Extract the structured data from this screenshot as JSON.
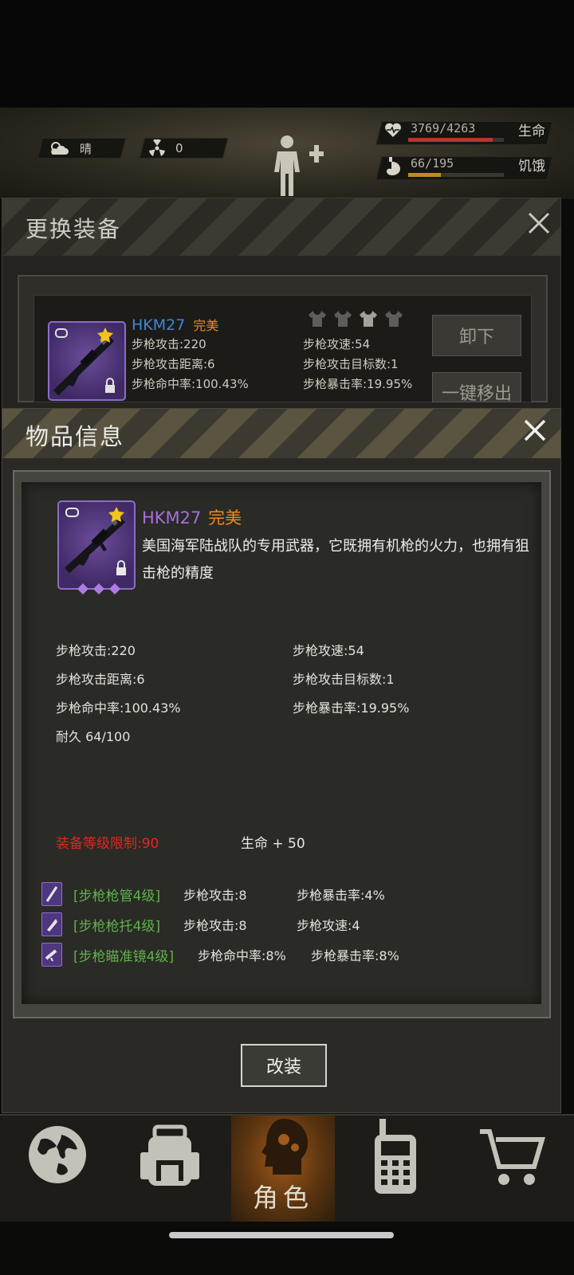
{
  "status": {
    "weather": "晴",
    "radiation": "0",
    "health": {
      "value": "3769/4263",
      "label": "生命",
      "ratio": 0.884,
      "color": "#b8352e"
    },
    "hunger": {
      "value": "66/195",
      "label": "饥饿",
      "ratio": 0.338,
      "color": "#c08a1e"
    }
  },
  "equip_panel": {
    "title": "更换装备",
    "item": {
      "name": "HKM27",
      "quality": "完美",
      "stats_left": [
        "步枪攻击:220",
        "步枪攻击距离:6",
        "步枪命中率:100.43%"
      ],
      "stats_right": [
        "步枪攻速:54",
        "步枪攻击目标数:1",
        "步枪暴击率:19.95%"
      ]
    },
    "unequip_label": "卸下",
    "remove_all_label": "一键移出"
  },
  "item_info": {
    "title": "物品信息",
    "name": "HKM27",
    "quality": "完美",
    "description": "美国海军陆战队的专用武器，它既拥有机枪的火力，也拥有狙击枪的精度",
    "stats_left": [
      "步枪攻击:220",
      "步枪攻击距离:6",
      "步枪命中率:100.43%",
      "耐久 64/100"
    ],
    "stats_right": [
      "步枪攻速:54",
      "步枪攻击目标数:1",
      "步枪暴击率:19.95%"
    ],
    "level_req": "装备等级限制:90",
    "bonus": "生命 + 50",
    "mods": [
      {
        "name": "[步枪枪管4级]",
        "stat1": "步枪攻击:8",
        "stat2": "步枪暴击率:4%"
      },
      {
        "name": "[步枪枪托4级]",
        "stat1": "步枪攻击:8",
        "stat2": "步枪攻速:4"
      },
      {
        "name": "[步枪瞄准镜4级]",
        "stat1": "步枪命中率:8%",
        "stat2": "步枪暴击率:8%"
      }
    ],
    "modify_label": "改装"
  },
  "nav": {
    "active_label": "角色",
    "items": [
      "globe-icon",
      "backpack-icon",
      "character-icon",
      "radio-icon",
      "cart-icon"
    ]
  },
  "colors": {
    "purple_name": "#a66ee0",
    "orange_quality": "#f08a1c",
    "blue_name": "#3f86d8",
    "red_req": "#e3261f",
    "green_mod": "#5fb24a"
  }
}
